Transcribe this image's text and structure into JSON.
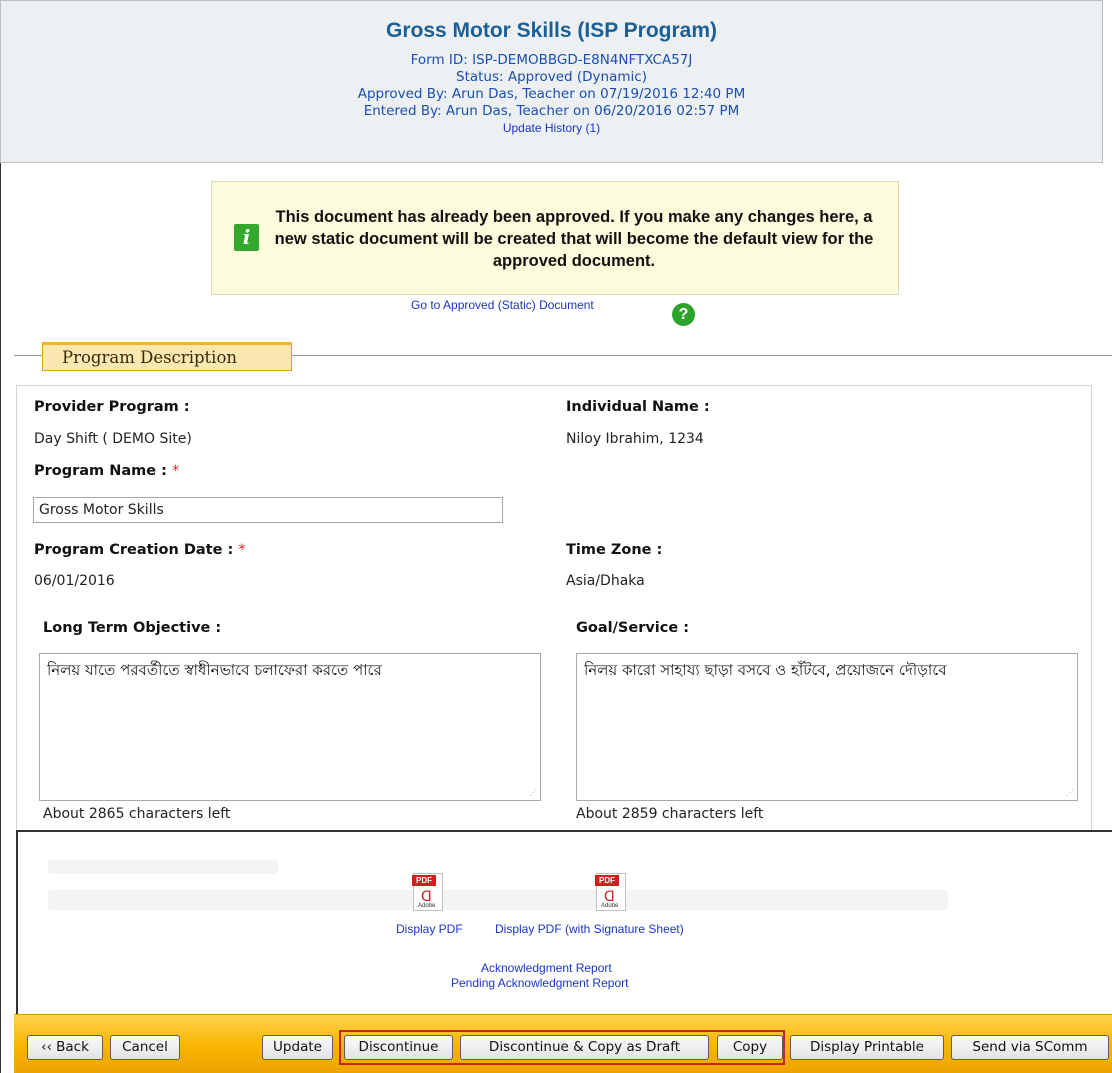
{
  "header": {
    "title": "Gross Motor Skills (ISP Program)",
    "form_id": "Form ID: ISP-DEMOBBGD-E8N4NFTXCA57J",
    "status": "Status: Approved (Dynamic)",
    "approved_by": "Approved By: Arun Das, Teacher  on 07/19/2016 12:40 PM",
    "entered_by": "Entered By: Arun Das, Teacher  on 06/20/2016 02:57 PM",
    "update_history": "Update History (1)"
  },
  "notice": {
    "icon": "info-icon",
    "message": "This document has already been approved. If you make any changes here, a new static document will be created that will become the default view for the approved document."
  },
  "approved_link": "Go to Approved (Static) Document",
  "help_icon": "?",
  "section": {
    "title": "Program Description"
  },
  "form": {
    "provider_program_label": "Provider Program :",
    "provider_program_value": "Day Shift ( DEMO Site)",
    "individual_name_label": "Individual Name :",
    "individual_name_value": "Niloy Ibrahim, 1234",
    "program_name_label": "Program Name :",
    "program_name_value": "Gross Motor Skills",
    "creation_date_label": "Program Creation Date :",
    "creation_date_value": "06/01/2016",
    "time_zone_label": "Time Zone :",
    "time_zone_value": "Asia/Dhaka",
    "required_mark": "*",
    "long_term_label": "Long Term Objective :",
    "long_term_value": "নিলয় যাতে পরবর্তীতে স্বাধীনভাবে চলাফেরা করতে পারে",
    "long_term_count": "About 2865 characters left",
    "goal_label": "Goal/Service :",
    "goal_value": "নিলয় কারো সাহায্য ছাড়া বসবে ও হাঁটবে, প্রয়োজনে দৌড়াবে",
    "goal_count": "About 2859 characters left"
  },
  "reports": {
    "pdf_tag": "PDF",
    "adobe_tag": "Adobe",
    "display_pdf": "Display PDF",
    "display_pdf_sig": "Display PDF (with Signature Sheet)",
    "ack_report": "Acknowledgment Report",
    "pending_ack_report": "Pending Acknowledgment Report"
  },
  "toolbar": {
    "back": "‹‹ Back",
    "cancel": "Cancel",
    "update": "Update",
    "discontinue": "Discontinue",
    "discontinue_copy": "Discontinue & Copy as Draft",
    "copy": "Copy",
    "display_printable": "Display Printable",
    "send_scomm": "Send via SComm"
  },
  "colors": {
    "accent": "#1b5f97",
    "toolbar": "#f8b400",
    "highlight": "#c6262a"
  }
}
